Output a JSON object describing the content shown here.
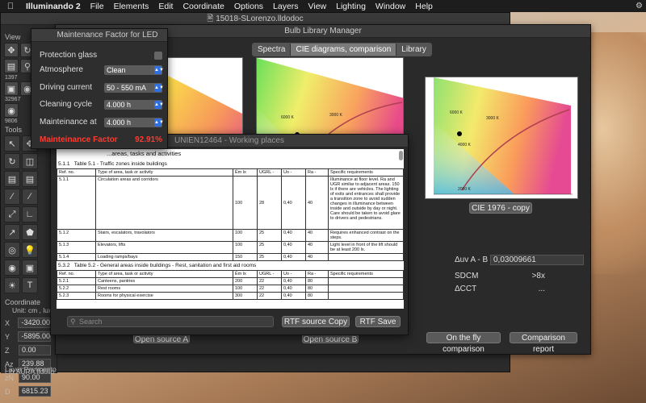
{
  "menubar": {
    "app_name": "Illuminando 2",
    "items": [
      "File",
      "Elements",
      "Edit",
      "Coordinate",
      "Options",
      "Layers",
      "View",
      "Lighting",
      "Window",
      "Help"
    ]
  },
  "main_window": {
    "title": "15018-SLorenzo.lldodoc",
    "left_panel": {
      "view_label": "View",
      "small_values": [
        "1397",
        "32967",
        "9806"
      ],
      "tools_label": "Tools",
      "coordinate_label": "Coordinate",
      "unit_text": "Unit: cm , lux",
      "coords": [
        {
          "label": "X",
          "value": "-3420.00"
        },
        {
          "label": "Y",
          "value": "-5895.00"
        },
        {
          "label": "Z",
          "value": "0.00"
        },
        {
          "label": "Az",
          "value": "239.88"
        },
        {
          "label": "zN",
          "value": "90.00"
        },
        {
          "label": "D",
          "value": "6815.23"
        }
      ],
      "layer_text": "Layer:Pavimento",
      "lib_text": "Lib:AURA.lldolib"
    }
  },
  "bulb_library": {
    "title": "Bulb Library Manager",
    "tabs": [
      "Spectra",
      "CIE diagrams, comparison",
      "Library"
    ],
    "active_tab_index": 1,
    "chart_caption_right": "CIE 1976 - copy",
    "metrics": [
      {
        "label": "Δuv A - B",
        "value": "0,03009661"
      },
      {
        "label": "SDCM",
        "value": ">8x"
      },
      {
        "label": "ΔCCT",
        "value": "..."
      }
    ],
    "buttons": {
      "open_a": "Open source A",
      "open_b": "Open source B",
      "fly_comparison": "On the fly comparison",
      "comparison_report": "Comparison report"
    }
  },
  "working_places": {
    "title": "UNIEN12464 - Working places",
    "doc_heading": "...areas, tasks and activities",
    "table1_caption": "Table 5.1 - Traffic zones inside buildings",
    "table1_num": "5.1.1",
    "table2_caption": "Table 5.2 - General areas inside buildings - Rest, sanitation and first aid rooms",
    "table2_num": "5.3.2",
    "columns": [
      "Ref. no.",
      "Type of area, task or activity",
      "Ēm lx",
      "UGRL -",
      "Uo -",
      "Ra -",
      "Specific requirements"
    ],
    "rows1": [
      {
        "ref": "5.1.1",
        "type": "Circulation areas and corridors",
        "em": "100",
        "ugr": "28",
        "uo": "0,40",
        "ra": "40",
        "req": "Illuminance at floor level. Ra and UGR similar to adjacent areas. 150 lx if there are vehicles. The lighting of exits and entrances shall provide a transition zone to avoid sudden changes in illuminance between inside and outside by day or night. Care should be taken to avoid glare to drivers and pedestrians."
      },
      {
        "ref": "5.1.2",
        "type": "Stairs, escalators, travolators",
        "em": "100",
        "ugr": "25",
        "uo": "0,40",
        "ra": "40",
        "req": "Requires enhanced contrast on the steps."
      },
      {
        "ref": "5.1.3",
        "type": "Elevators, lifts",
        "em": "100",
        "ugr": "25",
        "uo": "0,40",
        "ra": "40",
        "req": "Light level in front of the lift should be at least 200 lx."
      },
      {
        "ref": "5.1.4",
        "type": "Loading ramps/bays",
        "em": "150",
        "ugr": "25",
        "uo": "0,40",
        "ra": "40",
        "req": ""
      }
    ],
    "rows2": [
      {
        "ref": "5.2.1",
        "type": "Canteens, pantries",
        "em": "200",
        "ugr": "22",
        "uo": "0,40",
        "ra": "80"
      },
      {
        "ref": "5.2.2",
        "type": "Rest rooms",
        "em": "100",
        "ugr": "22",
        "uo": "0,40",
        "ra": "80"
      },
      {
        "ref": "5.2.3",
        "type": "Rooms for physical exercise",
        "em": "300",
        "ugr": "22",
        "uo": "0,40",
        "ra": "80"
      }
    ],
    "search_placeholder": "Search",
    "rtf_copy": "RTF source Copy",
    "rtf_save": "RTF Save"
  },
  "maintenance_dialog": {
    "title": "Maintenance Factor for LED",
    "protection_glass_label": "Protection glass",
    "atmosphere_label": "Atmosphere",
    "atmosphere_value": "Clean",
    "driving_current_label": "Driving current",
    "driving_current_value": "50 - 550 mA",
    "cleaning_cycle_label": "Cleaning cycle",
    "cleaning_cycle_value": "4.000 h",
    "maintenance_at_label": "Mainteinance at",
    "maintenance_at_value": "4.000 h",
    "result_label": "Mainteinance Factor",
    "result_value": "92.91%",
    "accent_color": "#ff3b30"
  },
  "cie_ticks": {
    "cct_labels": [
      "6000 K",
      "5000 K",
      "4000 K",
      "3000 K",
      "2500 K",
      "2000 K"
    ]
  }
}
